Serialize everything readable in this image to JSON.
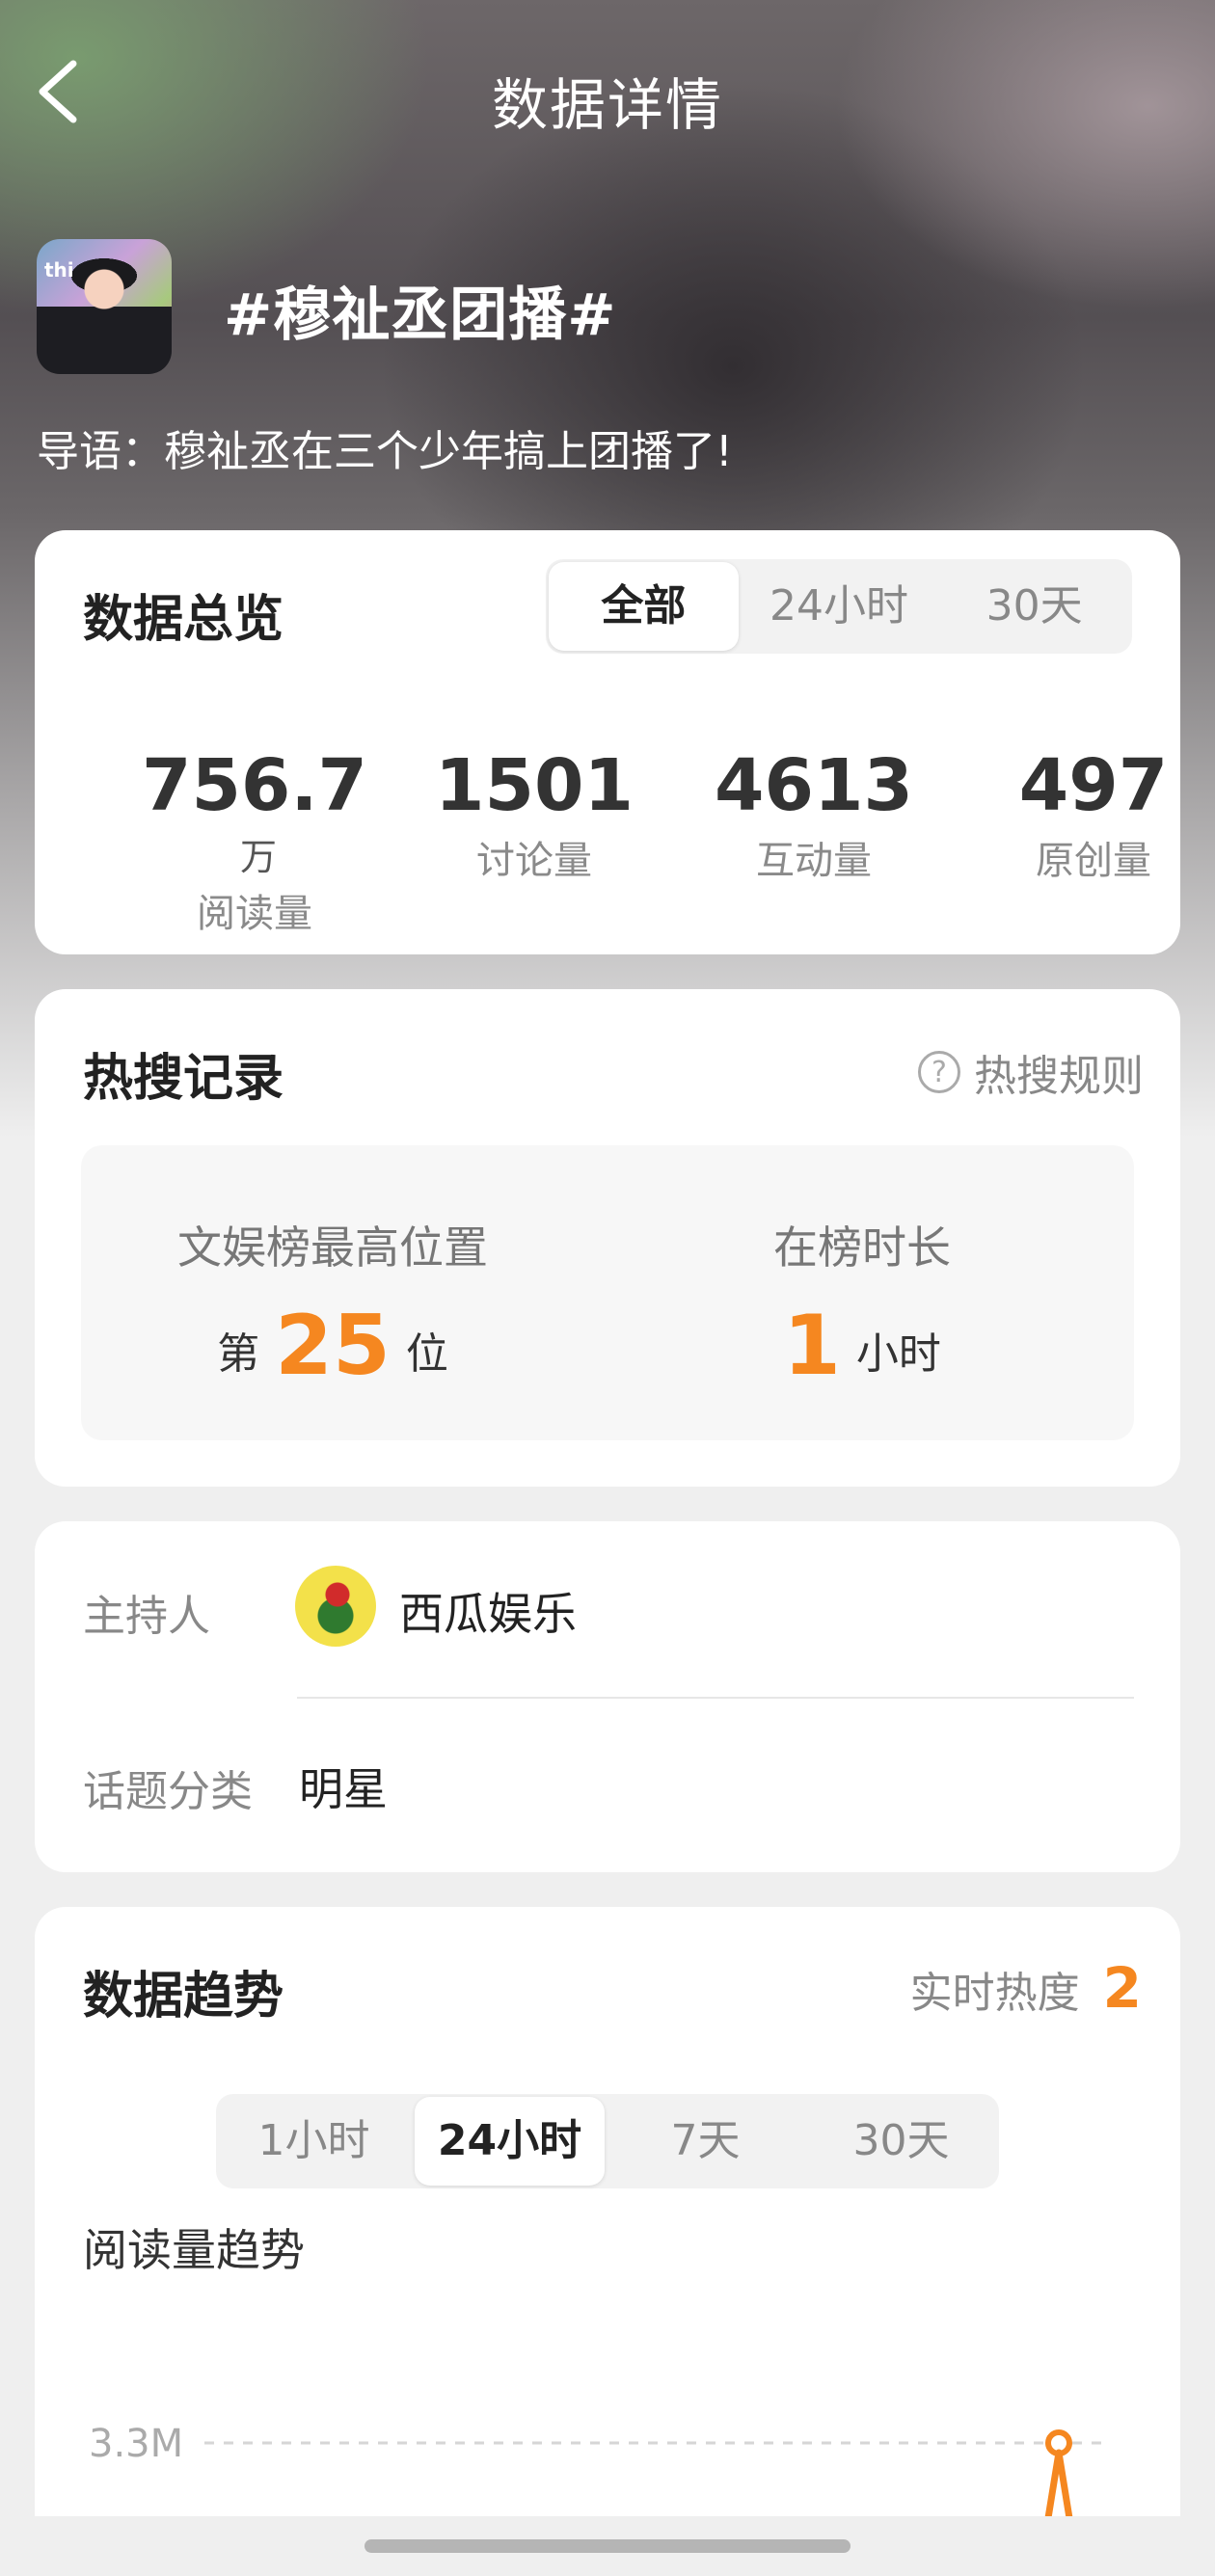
{
  "header": {
    "title": "数据详情"
  },
  "topic": {
    "title": "#穆祉丞团播#",
    "guide": "导语：穆祉丞在三个少年搞上团播了!",
    "avatar_text": "thi"
  },
  "overview": {
    "title": "数据总览",
    "tabs": [
      {
        "label": "全部",
        "active": true
      },
      {
        "label": "24小时",
        "active": false
      },
      {
        "label": "30天",
        "active": false
      }
    ],
    "stats": [
      {
        "value": "756.7",
        "unit": "万",
        "label": "阅读量"
      },
      {
        "value": "1501",
        "unit": "",
        "label": "讨论量"
      },
      {
        "value": "4613",
        "unit": "",
        "label": "互动量"
      },
      {
        "value": "497",
        "unit": "",
        "label": "原创量"
      }
    ]
  },
  "hotsearch": {
    "title": "热搜记录",
    "rule_link": "热搜规则",
    "best_rank": {
      "label": "文娱榜最高位置",
      "prefix": "第",
      "value": "25",
      "suffix": "位"
    },
    "duration": {
      "label": "在榜时长",
      "value": "1",
      "suffix": "小时"
    }
  },
  "meta": {
    "host_label": "主持人",
    "host_name": "西瓜娱乐",
    "host_icon_text": "西瓜娱乐",
    "category_label": "话题分类",
    "category_value": "明星"
  },
  "trend": {
    "title": "数据趋势",
    "realtime_label": "实时热度",
    "realtime_value": "2",
    "tabs": [
      {
        "label": "1小时",
        "active": false
      },
      {
        "label": "24小时",
        "active": true
      },
      {
        "label": "7天",
        "active": false
      },
      {
        "label": "30天",
        "active": false
      }
    ],
    "chart_title": "阅读量趋势",
    "y_tick": "3.3M"
  },
  "colors": {
    "accent": "#f58720",
    "card": "#ffffff",
    "page": "#efefef"
  }
}
